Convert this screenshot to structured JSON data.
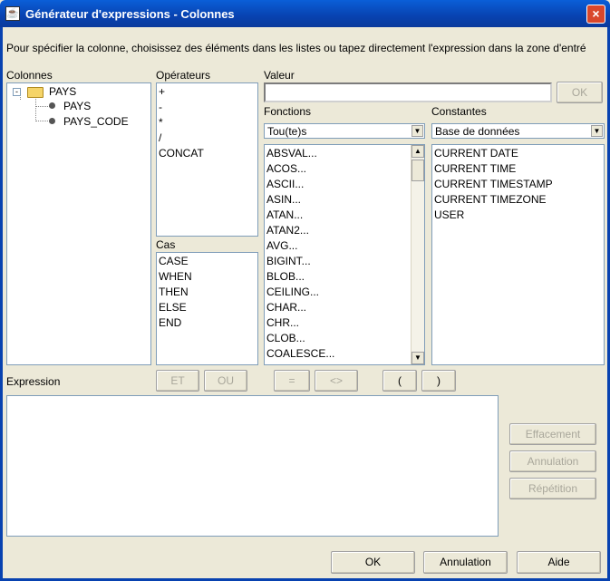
{
  "window": {
    "title": "Générateur d'expressions - Colonnes",
    "close_icon": "×"
  },
  "instruction": "Pour spécifier la colonne, choisissez des éléments dans les listes ou tapez directement l'expression dans la zone d'entré",
  "colonnes": {
    "label": "Colonnes",
    "root": "PAYS",
    "children": [
      "PAYS",
      "PAYS_CODE"
    ]
  },
  "operateurs": {
    "label": "Opérateurs",
    "items": [
      "+",
      "-",
      "*",
      "/",
      "CONCAT"
    ]
  },
  "cas": {
    "label": "Cas",
    "items": [
      "CASE",
      "WHEN",
      "THEN",
      "ELSE",
      "END"
    ]
  },
  "valeur": {
    "label": "Valeur",
    "value": "",
    "ok_label": "OK"
  },
  "fonctions": {
    "label": "Fonctions",
    "selected": "Tou(te)s",
    "items": [
      "ABSVAL...",
      "ACOS...",
      "ASCII...",
      "ASIN...",
      "ATAN...",
      "ATAN2...",
      "AVG...",
      "BIGINT...",
      "BLOB...",
      "CEILING...",
      "CHAR...",
      "CHR...",
      "CLOB...",
      "COALESCE..."
    ]
  },
  "constantes": {
    "label": "Constantes",
    "selected": "Base de données",
    "items": [
      "CURRENT DATE",
      "CURRENT TIME",
      "CURRENT TIMESTAMP",
      "CURRENT TIMEZONE",
      "USER"
    ]
  },
  "expression": {
    "label": "Expression",
    "value": "",
    "buttons": {
      "et": "ET",
      "ou": "OU",
      "eq": "=",
      "neq": "<>",
      "lparen": "(",
      "rparen": ")"
    }
  },
  "side_buttons": {
    "effacement": "Effacement",
    "annulation": "Annulation",
    "repetition": "Répétition"
  },
  "footer": {
    "ok": "OK",
    "annulation": "Annulation",
    "aide": "Aide"
  }
}
